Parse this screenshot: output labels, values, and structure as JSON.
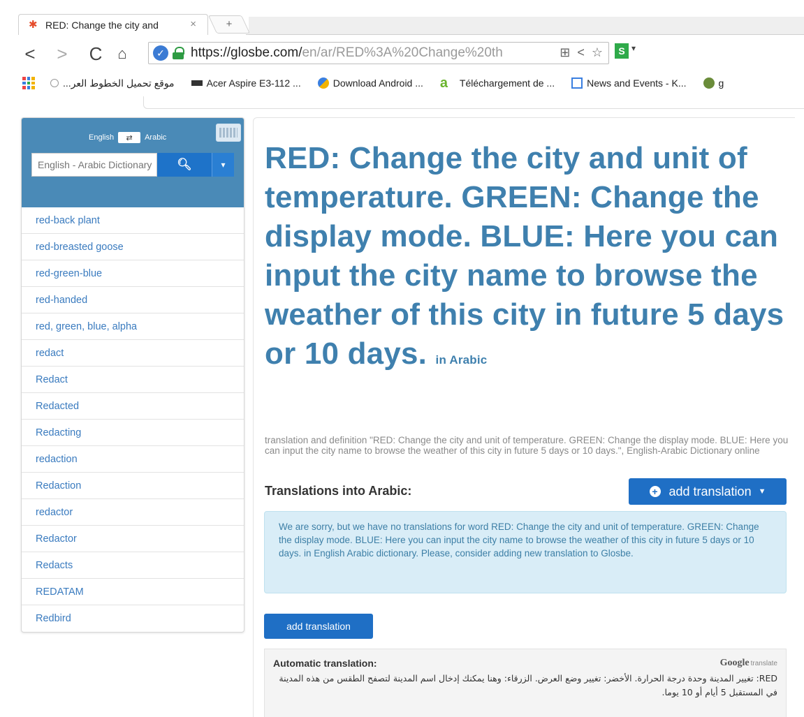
{
  "browser": {
    "tab_title": "RED: Change the city and",
    "tab_close": "×",
    "new_tab": "+",
    "nav": {
      "back": "<",
      "forward": ">",
      "reload": "C"
    },
    "url_host": "https://glosbe.com/",
    "url_path": "en/ar/RED%3A%20Change%20th",
    "ext_label": "S",
    "bookmarks": [
      "...موقع تحميل الخطوط العر",
      "Acer Aspire E3-112 ...",
      "Download Android ...",
      "Téléchargement de ...",
      "News and Events - K...",
      "g"
    ]
  },
  "sidebar": {
    "lang_from": "English",
    "lang_to": "Arabic",
    "search_placeholder": "English - Arabic Dictionary",
    "words": [
      "red-back plant",
      "red-breasted goose",
      "red-green-blue",
      "red-handed",
      "red, green, blue, alpha",
      "redact",
      "Redact",
      "Redacted",
      "Redacting",
      "redaction",
      "Redaction",
      "redactor",
      "Redactor",
      "Redacts",
      "REDATAM",
      "Redbird"
    ]
  },
  "main": {
    "headline": "RED: Change the city and unit of temperature. GREEN: Change the display mode. BLUE: Here you can input the city name to browse the weather of this city in future 5 days or 10 days.",
    "headline_suffix": "in Arabic",
    "subtitle": "translation and definition \"RED: Change the city and unit of temperature. GREEN: Change the display mode. BLUE: Here you can input the city name to browse the weather of this city in future 5 days or 10 days.\", English-Arabic Dictionary online",
    "translations_heading": "Translations into Arabic:",
    "add_translation_top": "add translation",
    "notice": "We are sorry, but we have no translations for word RED: Change the city and unit of temperature. GREEN: Change the display mode. BLUE: Here you can input the city name to browse the weather of this city in future 5 days or 10 days. in English Arabic dictionary. Please, consider adding new translation to Glosbe.",
    "add_translation_button": "add translation",
    "auto_title": "Automatic translation:",
    "google_label": "Google",
    "google_suffix": "translate",
    "auto_text": "RED: تغيير المدينة وحدة درجة الحرارة. الأخضر: تغيير وضع العرض. الزرقاء: وهنا يمكنك إدخال اسم المدينة لتصفح الطقس من هذه المدينة في المستقبل 5 أيام أو 10 يوما."
  }
}
